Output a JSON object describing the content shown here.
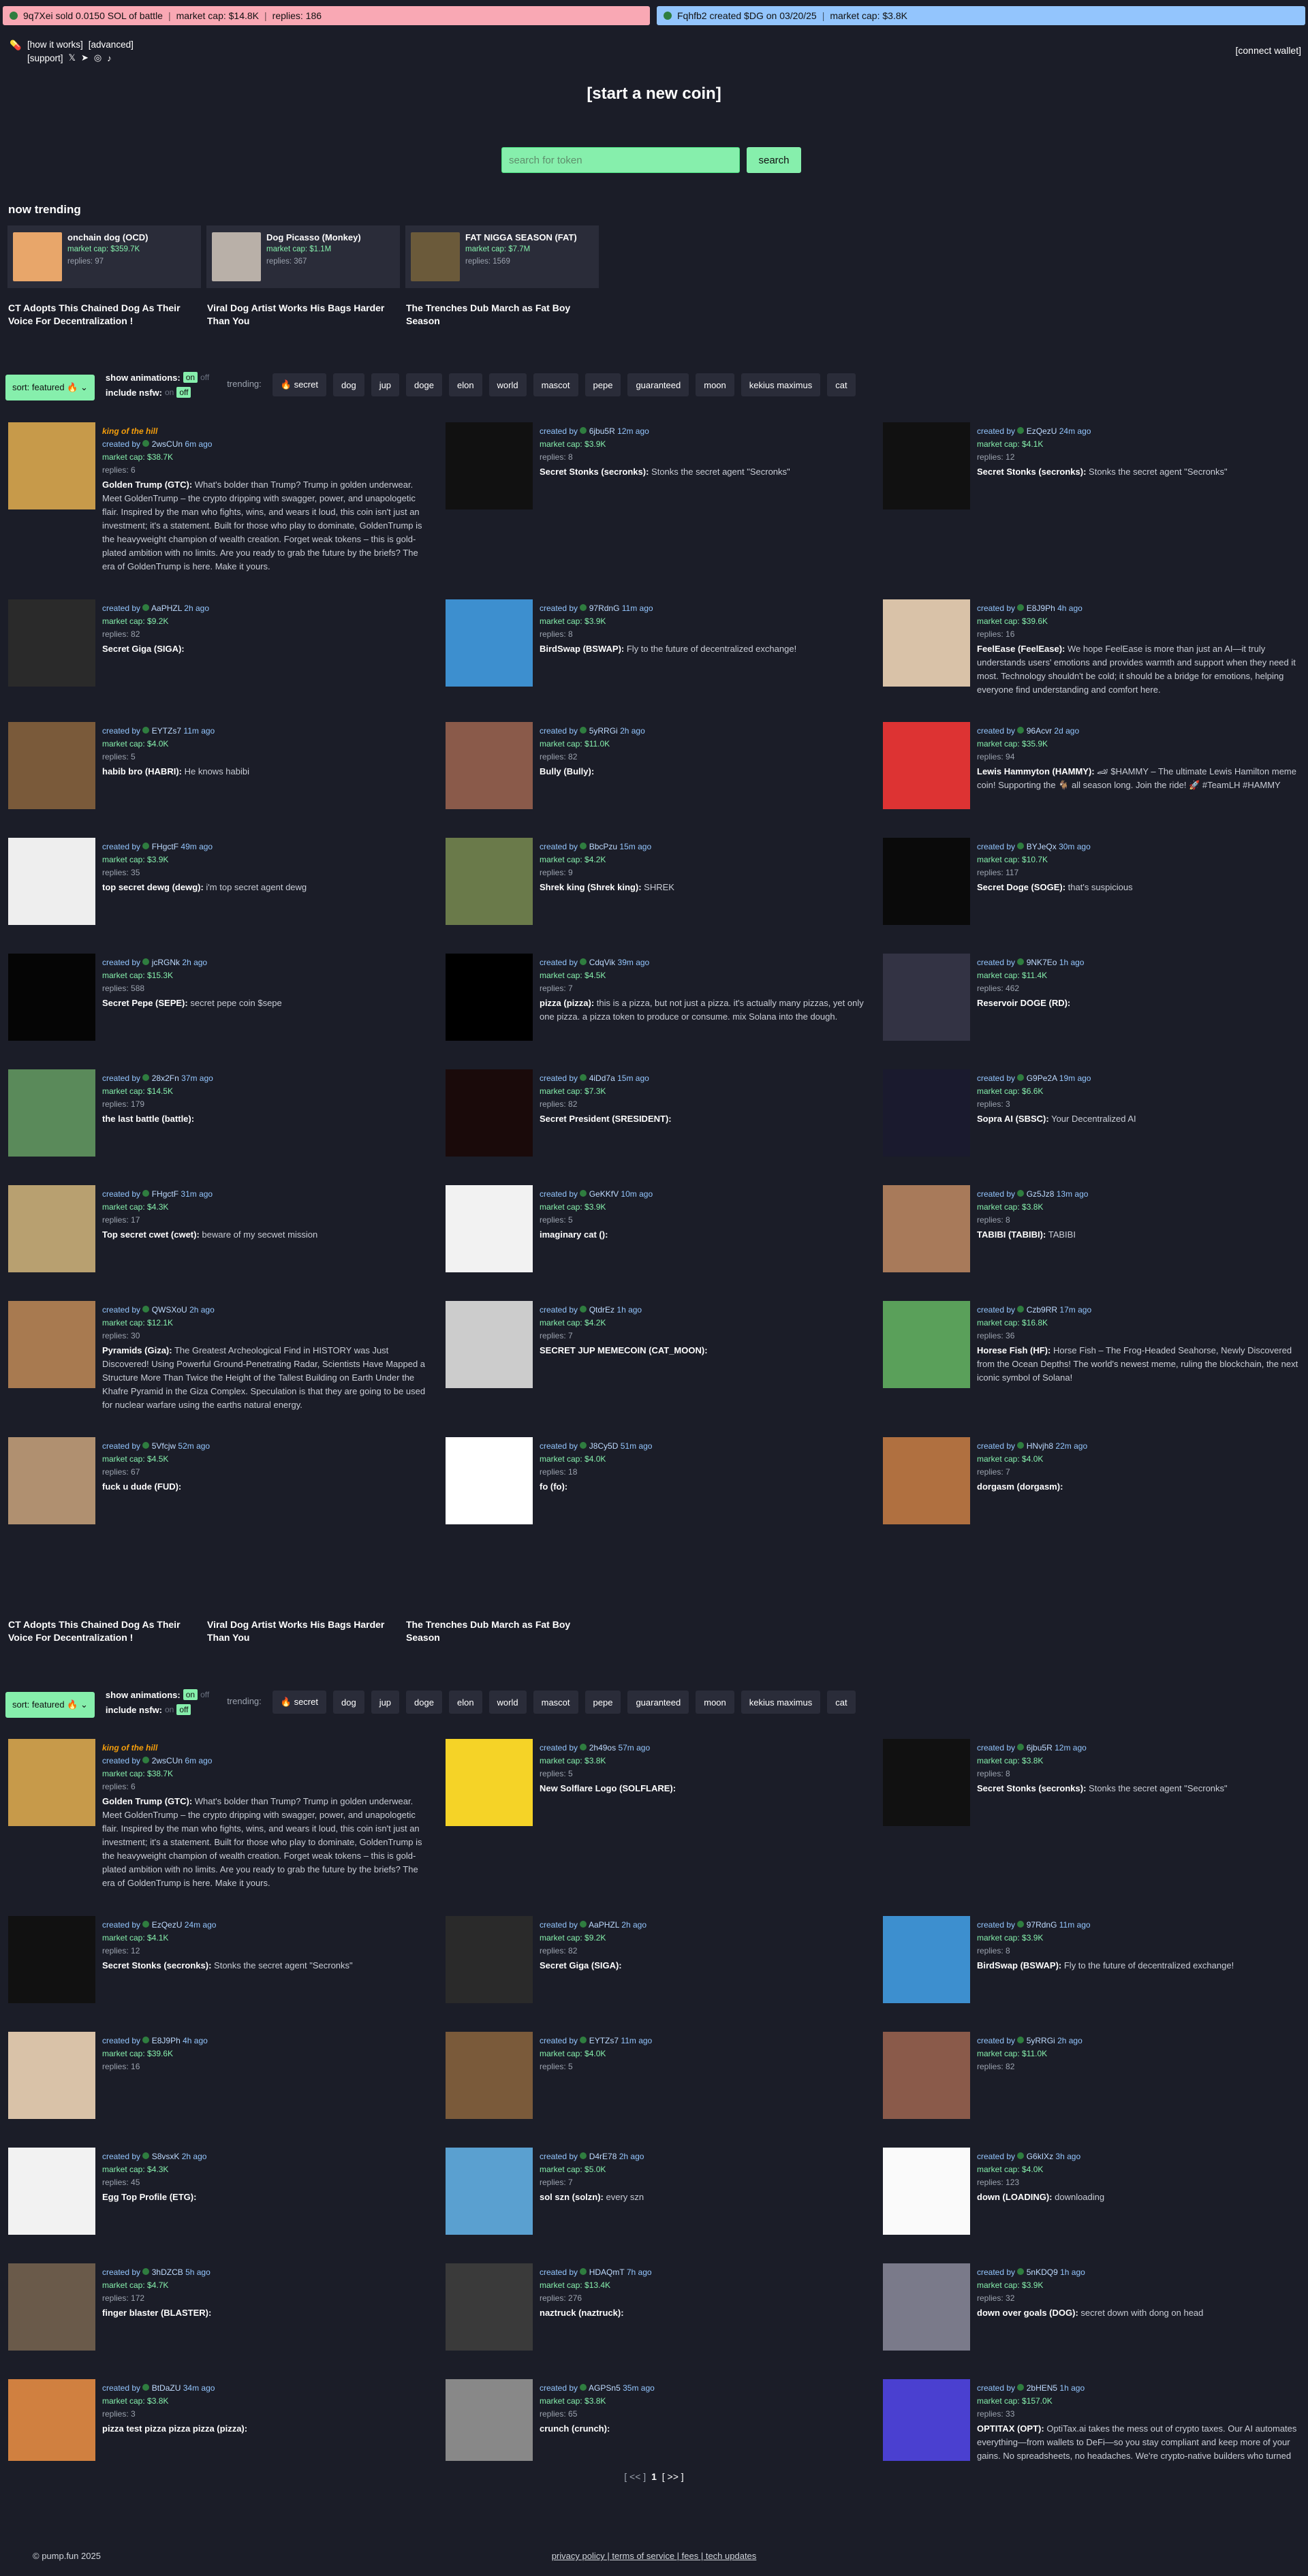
{
  "tickers": [
    {
      "text": "9q7Xei sold 0.0150 SOL of battle",
      "mcap": "market cap: $14.8K",
      "replies": "replies: 186",
      "color": "#f9a8b4"
    },
    {
      "text": "Fqhfb2 created $DG on 03/20/25",
      "mcap": "market cap: $3.8K",
      "color": "#93c5fd"
    }
  ],
  "nav": {
    "how": "[how it works]",
    "advanced": "[advanced]",
    "support": "[support]",
    "connect": "[connect wallet]"
  },
  "start": "[start a new coin]",
  "search": {
    "placeholder": "search for token",
    "button": "search"
  },
  "trending": {
    "title": "now trending",
    "cards": [
      {
        "name": "onchain dog (OCD)",
        "mcap": "market cap: $359.7K",
        "replies": "replies: 97",
        "color": "#e8a66a"
      },
      {
        "name": "Dog Picasso (Monkey)",
        "mcap": "market cap: $1.1M",
        "replies": "replies: 367",
        "color": "#b9b0a8"
      },
      {
        "name": "FAT NIGGA SEASON (FAT)",
        "mcap": "market cap: $7.7M",
        "replies": "replies: 1569",
        "color": "#6b5a3a"
      }
    ],
    "headlines": [
      "CT Adopts This Chained Dog As Their Voice For Decentralization !",
      "Viral Dog Artist Works His Bags Harder Than You",
      "The Trenches Dub March as Fat Boy Season"
    ]
  },
  "controls": {
    "sort": "sort: featured 🔥 ⌄",
    "anim": "show animations:",
    "on": "on",
    "off": "off",
    "nsfw": "include nsfw:",
    "trending": "trending:",
    "chips": [
      "🔥 secret",
      "dog",
      "jup",
      "doge",
      "elon",
      "world",
      "mascot",
      "pepe",
      "guaranteed",
      "moon",
      "kekius maximus",
      "cat"
    ]
  },
  "grid1": [
    {
      "user": "2wsCUn",
      "time": "6m ago",
      "mcap": "market cap: $38.7K",
      "replies": "replies: 6",
      "name": "Golden Trump (GTC):",
      "desc": "What's bolder than Trump? Trump in golden underwear. Meet GoldenTrump – the crypto dripping with swagger, power, and unapologetic flair. Inspired by the man who fights, wins, and wears it loud, this coin isn't just an investment; it's a statement. Built for those who play to dominate, GoldenTrump is the heavyweight champion of wealth creation. Forget weak tokens – this is gold-plated ambition with no limits. Are you ready to grab the future by the briefs? The era of GoldenTrump is here. Make it yours.",
      "koth": "king of the hill",
      "color": "#c79a4a"
    },
    {
      "user": "6jbu5R",
      "time": "12m ago",
      "mcap": "market cap: $3.9K",
      "replies": "replies: 8",
      "name": "Secret Stonks (secronks):",
      "desc": "Stonks the secret agent \"Secronks\"",
      "color": "#111"
    },
    {
      "user": "EzQezU",
      "time": "24m ago",
      "mcap": "market cap: $4.1K",
      "replies": "replies: 12",
      "name": "Secret Stonks (secronks):",
      "desc": "Stonks the secret agent \"Secronks\"",
      "color": "#111"
    },
    {
      "user": "AaPHZL",
      "time": "2h ago",
      "mcap": "market cap: $9.2K",
      "replies": "replies: 82",
      "name": "Secret Giga (SIGA):",
      "desc": "",
      "color": "#2a2a2a"
    },
    {
      "user": "97RdnG",
      "time": "11m ago",
      "mcap": "market cap: $3.9K",
      "replies": "replies: 8",
      "name": "BirdSwap (BSWAP):",
      "desc": "Fly to the future of decentralized exchange!",
      "color": "#3d8fcf"
    },
    {
      "user": "E8J9Ph",
      "time": "4h ago",
      "mcap": "market cap: $39.6K",
      "replies": "replies: 16",
      "name": "FeelEase (FeelEase):",
      "desc": "We hope FeelEase is more than just an AI—it truly understands users' emotions and provides warmth and support when they need it most. Technology shouldn't be cold; it should be a bridge for emotions, helping everyone find understanding and comfort here.",
      "color": "#d9c2a8"
    },
    {
      "user": "EYTZs7",
      "time": "11m ago",
      "mcap": "market cap: $4.0K",
      "replies": "replies: 5",
      "name": "habib bro (HABRI):",
      "desc": "He knows habibi",
      "color": "#7a5a3a"
    },
    {
      "user": "5yRRGi",
      "time": "2h ago",
      "mcap": "market cap: $11.0K",
      "replies": "replies: 82",
      "name": "Bully (Bully):",
      "desc": "",
      "color": "#8a5a4a"
    },
    {
      "user": "96Acvr",
      "time": "2d ago",
      "mcap": "market cap: $35.9K",
      "replies": "replies: 94",
      "name": "Lewis Hammyton (HAMMY):",
      "desc": "🏎 $HAMMY – The ultimate Lewis Hamilton meme coin! Supporting the 🐐 all season long. Join the ride! 🚀 #TeamLH #HAMMY",
      "color": "#d33"
    },
    {
      "user": "FHgctF",
      "time": "49m ago",
      "mcap": "market cap: $3.9K",
      "replies": "replies: 35",
      "name": "top secret dewg (dewg):",
      "desc": "i'm top secret agent dewg",
      "color": "#eee"
    },
    {
      "user": "BbcPzu",
      "time": "15m ago",
      "mcap": "market cap: $4.2K",
      "replies": "replies: 9",
      "name": "Shrek king (Shrek king):",
      "desc": "SHREK",
      "color": "#6a7a4a"
    },
    {
      "user": "BYJeQx",
      "time": "30m ago",
      "mcap": "market cap: $10.7K",
      "replies": "replies: 117",
      "name": "Secret Doge (SOGE):",
      "desc": "that's suspicious",
      "color": "#0a0a0a"
    },
    {
      "user": "jcRGNk",
      "time": "2h ago",
      "mcap": "market cap: $15.3K",
      "replies": "replies: 588",
      "name": "Secret Pepe (SEPE):",
      "desc": "secret pepe coin $sepe",
      "color": "#050505"
    },
    {
      "user": "CdqVik",
      "time": "39m ago",
      "mcap": "market cap: $4.5K",
      "replies": "replies: 7",
      "name": "pizza (pizza):",
      "desc": "this is a pizza, but not just a pizza. it's actually many pizzas, yet only one pizza. a pizza token to produce or consume. mix Solana into the dough.",
      "color": "#000"
    },
    {
      "user": "9NK7Eo",
      "time": "1h ago",
      "mcap": "market cap: $11.4K",
      "replies": "replies: 462",
      "name": "Reservoir DOGE (RD):",
      "desc": "",
      "color": "#334"
    },
    {
      "user": "28x2Fn",
      "time": "37m ago",
      "mcap": "market cap: $14.5K",
      "replies": "replies: 179",
      "name": "the last battle (battle):",
      "desc": "",
      "color": "#5a8a5a"
    },
    {
      "user": "4iDd7a",
      "time": "15m ago",
      "mcap": "market cap: $7.3K",
      "replies": "replies: 82",
      "name": "Secret President (SRESIDENT):",
      "desc": "",
      "color": "#1a0a0a"
    },
    {
      "user": "G9Pe2A",
      "time": "19m ago",
      "mcap": "market cap: $6.6K",
      "replies": "replies: 3",
      "name": "Sopra AI (SBSC):",
      "desc": "Your Decentralized AI",
      "color": "#1a1a2e"
    },
    {
      "user": "FHgctF",
      "time": "31m ago",
      "mcap": "market cap: $4.3K",
      "replies": "replies: 17",
      "name": "Top secret cwet (cwet):",
      "desc": "beware of my secwet mission",
      "color": "#b8a070"
    },
    {
      "user": "GeKKfV",
      "time": "10m ago",
      "mcap": "market cap: $3.9K",
      "replies": "replies: 5",
      "name": "imaginary cat ():",
      "desc": "",
      "color": "#f2f2f2"
    },
    {
      "user": "Gz5Jz8",
      "time": "13m ago",
      "mcap": "market cap: $3.8K",
      "replies": "replies: 8",
      "name": "TABIBI (TABIBI):",
      "desc": "TABIBI",
      "color": "#a87a5a"
    },
    {
      "user": "QWSXoU",
      "time": "2h ago",
      "mcap": "market cap: $12.1K",
      "replies": "replies: 30",
      "name": "Pyramids (Giza):",
      "desc": "The Greatest Archeological Find in HISTORY was Just Discovered! Using Powerful Ground-Penetrating Radar, Scientists Have Mapped a Structure More Than Twice the Height of the Tallest Building on Earth Under the Khafre Pyramid in the Giza Complex. Speculation is that they are going to be used for nuclear warfare using the earths natural energy.",
      "color": "#a87a50"
    },
    {
      "user": "QtdrEz",
      "time": "1h ago",
      "mcap": "market cap: $4.2K",
      "replies": "replies: 7",
      "name": "SECRET JUP MEMECOIN (CAT_MOON):",
      "desc": "",
      "color": "#ccc"
    },
    {
      "user": "Czb9RR",
      "time": "17m ago",
      "mcap": "market cap: $16.8K",
      "replies": "replies: 36",
      "name": "Horese Fish (HF):",
      "desc": "Horse Fish – The Frog-Headed Seahorse, Newly Discovered from the Ocean Depths! The world's newest meme, ruling the blockchain, the next iconic symbol of Solana!",
      "color": "#5aa05a"
    },
    {
      "user": "5Vfcjw",
      "time": "52m ago",
      "mcap": "market cap: $4.5K",
      "replies": "replies: 67",
      "name": "fuck u dude (FUD):",
      "desc": "",
      "color": "#b09070"
    },
    {
      "user": "J8Cy5D",
      "time": "51m ago",
      "mcap": "market cap: $4.0K",
      "replies": "replies: 18",
      "name": "fo (fo):",
      "desc": "",
      "color": "#ffffff"
    },
    {
      "user": "HNvjh8",
      "time": "22m ago",
      "mcap": "market cap: $4.0K",
      "replies": "replies: 7",
      "name": "dorgasm (dorgasm):",
      "desc": "",
      "color": "#b07040"
    }
  ],
  "grid2": [
    {
      "user": "2wsCUn",
      "time": "6m ago",
      "mcap": "market cap: $38.7K",
      "replies": "replies: 6",
      "name": "Golden Trump (GTC):",
      "desc": "What's bolder than Trump? Trump in golden underwear. Meet GoldenTrump – the crypto dripping with swagger, power, and unapologetic flair. Inspired by the man who fights, wins, and wears it loud, this coin isn't just an investment; it's a statement. Built for those who play to dominate, GoldenTrump is the heavyweight champion of wealth creation. Forget weak tokens – this is gold-plated ambition with no limits. Are you ready to grab the future by the briefs? The era of GoldenTrump is here. Make it yours.",
      "koth": "king of the hill",
      "color": "#c79a4a"
    },
    {
      "user": "2h49os",
      "time": "57m ago",
      "mcap": "market cap: $3.8K",
      "replies": "replies: 5",
      "name": "New Solflare Logo (SOLFLARE):",
      "desc": "",
      "color": "#f5d327"
    },
    {
      "user": "6jbu5R",
      "time": "12m ago",
      "mcap": "market cap: $3.8K",
      "replies": "replies: 8",
      "name": "Secret Stonks (secronks):",
      "desc": "Stonks the secret agent \"Secronks\"",
      "color": "#111"
    },
    {
      "user": "EzQezU",
      "time": "24m ago",
      "mcap": "market cap: $4.1K",
      "replies": "replies: 12",
      "name": "Secret Stonks (secronks):",
      "desc": "Stonks the secret agent \"Secronks\"",
      "color": "#111"
    },
    {
      "user": "AaPHZL",
      "time": "2h ago",
      "mcap": "market cap: $9.2K",
      "replies": "replies: 82",
      "name": "Secret Giga (SIGA):",
      "desc": "",
      "color": "#2a2a2a"
    },
    {
      "user": "97RdnG",
      "time": "11m ago",
      "mcap": "market cap: $3.9K",
      "replies": "replies: 8",
      "name": "BirdSwap (BSWAP):",
      "desc": "Fly to the future of decentralized exchange!",
      "color": "#3d8fcf"
    },
    {
      "user": "E8J9Ph",
      "time": "4h ago",
      "mcap": "market cap: $39.6K",
      "replies": "replies: 16",
      "name": "",
      "desc": "",
      "color": "#d9c2a8"
    },
    {
      "user": "EYTZs7",
      "time": "11m ago",
      "mcap": "market cap: $4.0K",
      "replies": "replies: 5",
      "name": "",
      "desc": "",
      "color": "#7a5a3a"
    },
    {
      "user": "5yRRGi",
      "time": "2h ago",
      "mcap": "market cap: $11.0K",
      "replies": "replies: 82",
      "name": "",
      "desc": "",
      "color": "#8a5a4a"
    },
    {
      "user": "S8vsxK",
      "time": "2h ago",
      "mcap": "market cap: $4.3K",
      "replies": "replies: 45",
      "name": "Egg Top Profile (ETG):",
      "desc": "",
      "color": "#f2f2f2"
    },
    {
      "user": "D4rE78",
      "time": "2h ago",
      "mcap": "market cap: $5.0K",
      "replies": "replies: 7",
      "name": "sol szn (solzn):",
      "desc": "every szn",
      "color": "#5aa0d0"
    },
    {
      "user": "G6kIXz",
      "time": "3h ago",
      "mcap": "market cap: $4.0K",
      "replies": "replies: 123",
      "name": "down (LOADING):",
      "desc": "downloading",
      "color": "#fafafa"
    },
    {
      "user": "3hDZCB",
      "time": "5h ago",
      "mcap": "market cap: $4.7K",
      "replies": "replies: 172",
      "name": "finger blaster (BLASTER):",
      "desc": "",
      "color": "#6a5a4a"
    },
    {
      "user": "HDAQmT",
      "time": "7h ago",
      "mcap": "market cap: $13.4K",
      "replies": "replies: 276",
      "name": "naztruck (naztruck):",
      "desc": "",
      "color": "#3a3a3a"
    },
    {
      "user": "5nKDQ9",
      "time": "1h ago",
      "mcap": "market cap: $3.9K",
      "replies": "replies: 32",
      "name": "down over goals (DOG):",
      "desc": "secret down with dong on head",
      "color": "#7a7a8a"
    },
    {
      "user": "BtDaZU",
      "time": "34m ago",
      "mcap": "market cap: $3.8K",
      "replies": "replies: 3",
      "name": "pizza test pizza pizza pizza (pizza):",
      "desc": "",
      "color": "#d08040"
    },
    {
      "user": "AGPSn5",
      "time": "35m ago",
      "mcap": "market cap: $3.8K",
      "replies": "replies: 65",
      "name": "crunch (crunch):",
      "desc": "",
      "color": "#888"
    },
    {
      "user": "2bHEN5",
      "time": "1h ago",
      "mcap": "market cap: $157.0K",
      "replies": "replies: 33",
      "name": "OPTITAX (OPT):",
      "desc": "OptiTax.ai takes the mess out of crypto taxes. Our AI automates everything—from wallets to DeFi—so you stay compliant and keep more of your gains. No spreadsheets, no headaches. We're crypto-native builders who turned tax chaos into an AI-powered solution. You focus on the grind, we'll handle the numbers.",
      "color": "#4a40d0"
    }
  ],
  "pager": {
    "prev": "[ << ]",
    "page": "1",
    "next": "[ >> ]"
  },
  "footer": {
    "copy": "© pump.fun 2025",
    "links": "privacy policy | terms of service | fees | tech updates"
  }
}
